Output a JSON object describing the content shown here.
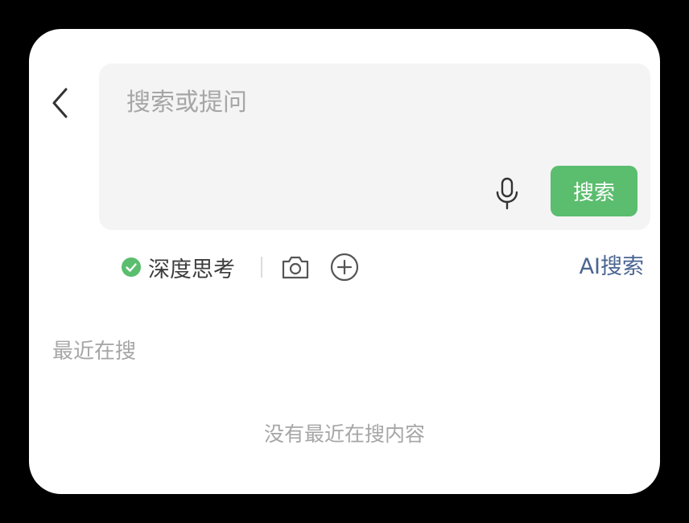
{
  "search": {
    "placeholder": "搜索或提问",
    "value": "",
    "button_label": "搜索"
  },
  "options": {
    "deep_think_label": "深度思考",
    "deep_think_enabled": true,
    "ai_search_label": "AI搜索"
  },
  "recent": {
    "title": "最近在搜",
    "empty_message": "没有最近在搜内容"
  },
  "icons": {
    "back": "chevron-left-icon",
    "mic": "microphone-icon",
    "check": "check-circle-icon",
    "camera": "camera-icon",
    "plus": "plus-circle-icon"
  },
  "colors": {
    "accent_green": "#5bbd6e",
    "link_blue": "#4a6591",
    "muted_text": "#a6a6a6",
    "input_background": "#f4f4f4"
  }
}
